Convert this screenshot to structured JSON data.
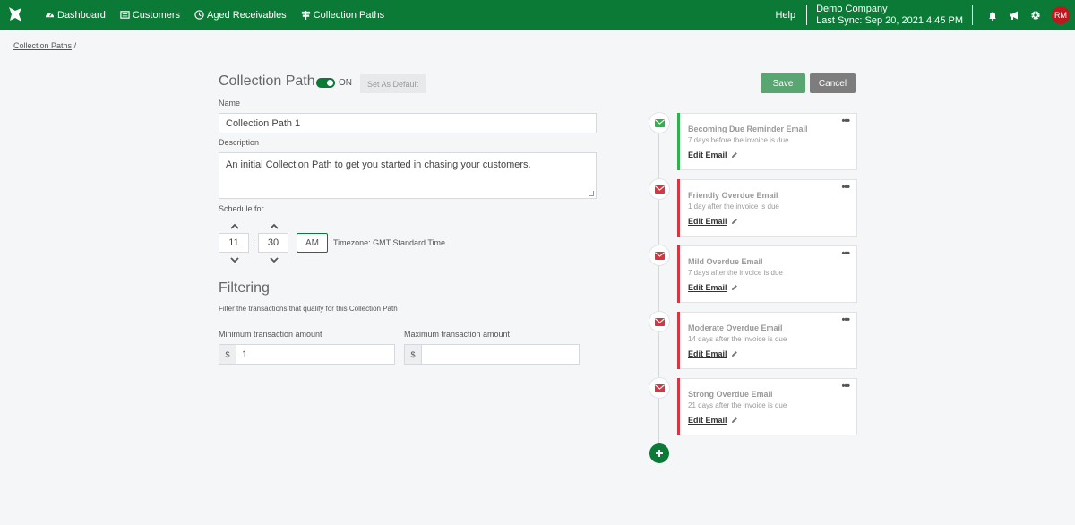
{
  "nav": {
    "items": [
      {
        "label": "Dashboard",
        "icon": "dashboard-icon"
      },
      {
        "label": "Customers",
        "icon": "customers-icon"
      },
      {
        "label": "Aged Receivables",
        "icon": "clock-icon"
      },
      {
        "label": "Collection Paths",
        "icon": "signpost-icon"
      }
    ],
    "help": "Help",
    "company": "Demo Company",
    "last_sync": "Last Sync: Sep 20, 2021 4:45 PM",
    "avatar_initials": "RM"
  },
  "breadcrumb": {
    "link": "Collection Paths",
    "separator": "/"
  },
  "form": {
    "title": "Collection Path",
    "toggle_state": "ON",
    "set_default_label": "Set As Default",
    "name_label": "Name",
    "name_value": "Collection Path 1",
    "description_label": "Description",
    "description_value": "An initial Collection Path to get you started in chasing your customers.",
    "schedule_label": "Schedule for",
    "hour": "11",
    "minute": "30",
    "time_separator": ":",
    "ampm": "AM",
    "timezone": "Timezone: GMT Standard Time"
  },
  "filtering": {
    "title": "Filtering",
    "description": "Filter the transactions that qualify for this Collection Path",
    "min_label": "Minimum transaction amount",
    "max_label": "Maximum transaction amount",
    "currency": "$",
    "min_value": "1",
    "max_value": ""
  },
  "actions": {
    "save": "Save",
    "cancel": "Cancel"
  },
  "timeline": {
    "edit_label": "Edit Email",
    "more_label": "•••",
    "steps": [
      {
        "title": "Becoming Due Reminder Email",
        "subtitle": "7 days before the invoice is due",
        "color": "#2db34a"
      },
      {
        "title": "Friendly Overdue Email",
        "subtitle": "1 day after the invoice is due",
        "color": "#d9343f"
      },
      {
        "title": "Mild Overdue Email",
        "subtitle": "7 days after the invoice is due",
        "color": "#d9343f"
      },
      {
        "title": "Moderate Overdue Email",
        "subtitle": "14 days after the invoice is due",
        "color": "#d9343f"
      },
      {
        "title": "Strong Overdue Email",
        "subtitle": "21 days after the invoice is due",
        "color": "#d9343f"
      }
    ]
  },
  "colors": {
    "brand": "#0a7a36",
    "due": "#2db34a",
    "overdue": "#d9343f"
  }
}
